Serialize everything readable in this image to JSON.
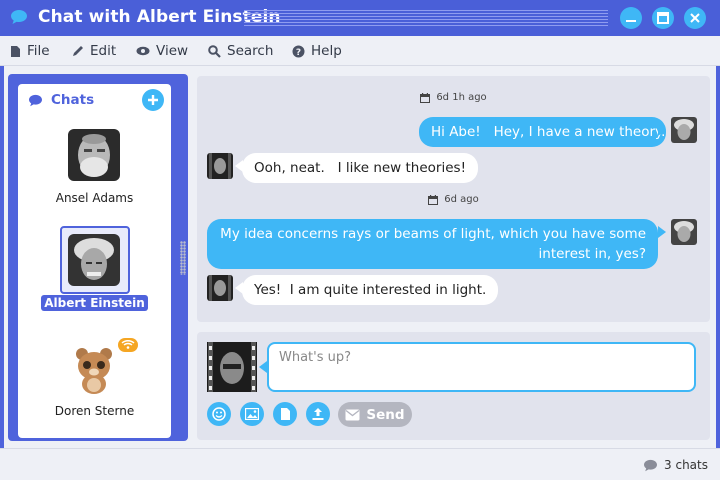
{
  "window": {
    "title": "Chat with Albert Einstein",
    "app_icon": "chat-bubble-icon",
    "controls": [
      "minimize-icon",
      "maximize-icon",
      "close-icon"
    ]
  },
  "menu": [
    {
      "label": "File",
      "icon": "file-icon"
    },
    {
      "label": "Edit",
      "icon": "pencil-icon"
    },
    {
      "label": "View",
      "icon": "eye-icon"
    },
    {
      "label": "Search",
      "icon": "search-icon"
    },
    {
      "label": "Help",
      "icon": "help-icon"
    }
  ],
  "sidebar": {
    "header": "Chats",
    "contacts": [
      {
        "name": "Ansel Adams",
        "active": false
      },
      {
        "name": "Albert Einstein",
        "active": true
      },
      {
        "name": "Doren Sterne",
        "active": false,
        "badge": "wifi-icon"
      }
    ]
  },
  "conversation": {
    "stamps": [
      "6d 1h ago",
      "6d ago"
    ],
    "messages": [
      {
        "from": "me",
        "text": "Hi Abe!   Hey, I have a new theory."
      },
      {
        "from": "them",
        "text": "Ooh, neat.   I like new theories!"
      },
      {
        "from": "me",
        "text": "My idea concerns rays or beams of light, which you have some interest in, yes?"
      },
      {
        "from": "them",
        "text": "Yes!  I am quite interested in light."
      }
    ]
  },
  "compose": {
    "placeholder": "What's up?",
    "value": "",
    "send_label": "Send",
    "tools": [
      "emoji-icon",
      "image-icon",
      "document-icon",
      "upload-icon"
    ]
  },
  "status": {
    "chat_count": "3 chats"
  },
  "colors": {
    "frame": "#4f63dc",
    "accent": "#3fb7f6",
    "panel": "#e1e3ed",
    "background": "#eef0f6"
  }
}
